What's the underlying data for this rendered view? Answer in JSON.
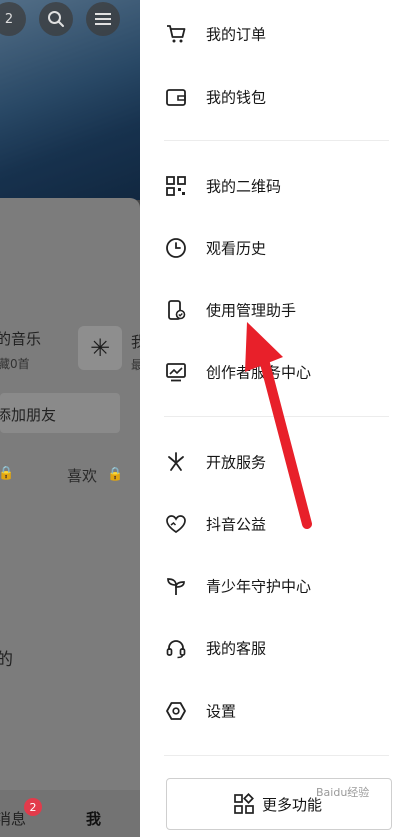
{
  "left_panel": {
    "top_badge_count": "2",
    "music_title": "的音乐",
    "music_sub": "藏0首",
    "side_label": "我",
    "side_sub": "最",
    "add_friend": "添加朋友",
    "likes_label": "喜欢",
    "partial_text": "的",
    "nav_messages": "消息",
    "nav_messages_badge": "2",
    "nav_me": "我"
  },
  "drawer": {
    "items": [
      {
        "label": "我的订单",
        "icon": "cart-icon"
      },
      {
        "label": "我的钱包",
        "icon": "wallet-icon"
      },
      {
        "label": "我的二维码",
        "icon": "qrcode-icon"
      },
      {
        "label": "观看历史",
        "icon": "clock-icon"
      },
      {
        "label": "使用管理助手",
        "icon": "phone-shield-icon"
      },
      {
        "label": "创作者服务中心",
        "icon": "monitor-chart-icon"
      },
      {
        "label": "开放服务",
        "icon": "asterisk-icon"
      },
      {
        "label": "抖音公益",
        "icon": "heart-hands-icon"
      },
      {
        "label": "青少年守护中心",
        "icon": "sprout-icon"
      },
      {
        "label": "我的客服",
        "icon": "headset-icon"
      },
      {
        "label": "设置",
        "icon": "settings-hexagon-icon"
      }
    ],
    "more_label": "更多功能"
  },
  "annotation": {
    "arrow_color": "#e8202a"
  },
  "watermark": "Baidu经验"
}
